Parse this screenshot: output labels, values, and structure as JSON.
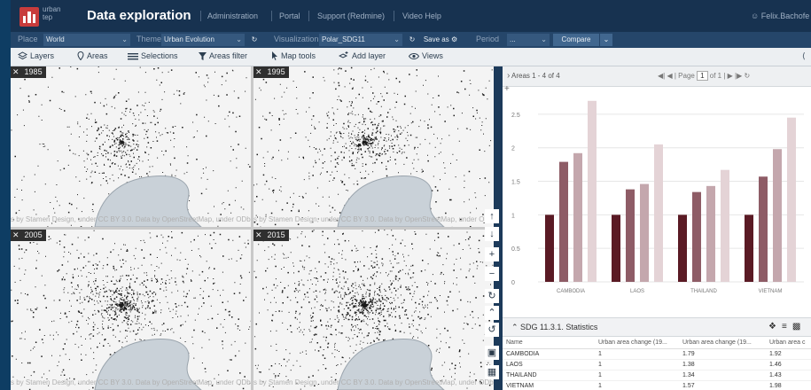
{
  "header": {
    "logo_text": "urban tep",
    "title": "Data exploration",
    "nav": [
      "Administration",
      "Portal",
      "Support (Redmine)",
      "Video Help"
    ],
    "user": "Felix.Bachofe"
  },
  "filters": {
    "place_label": "Place",
    "place_value": "World",
    "theme_label": "Theme",
    "theme_value": "Urban Evolution",
    "visualization_label": "Visualization",
    "visualization_value": "Polar_SDG11",
    "saveas_label": "Save as",
    "period_label": "Period",
    "period_value": "...",
    "compare_label": "Compare"
  },
  "toolbar": {
    "layers": "Layers",
    "areas": "Areas",
    "selections": "Selections",
    "areas_filter": "Areas filter",
    "map_tools": "Map tools",
    "add_layer": "Add layer",
    "views": "Views"
  },
  "maps": [
    {
      "year": "1985"
    },
    {
      "year": "1995"
    },
    {
      "year": "2005"
    },
    {
      "year": "2015"
    }
  ],
  "map_attribution": "s by Stamen Design, under CC BY 3.0. Data by OpenStreetMap, under ODbL",
  "map_controls": [
    "arrow-up",
    "arrow-down",
    "zoom-in",
    "zoom-out",
    "rotate-cw",
    "north",
    "rotate-ccw",
    "layers-grid",
    "grid"
  ],
  "panel": {
    "areas_count": "Areas 1 - 4 of 4",
    "page_label": "Page",
    "page_value": "1",
    "of_label": "of 1"
  },
  "chart_data": {
    "type": "bar",
    "categories": [
      "CAMBODIA",
      "LAOS",
      "THAILAND",
      "VIETNAM"
    ],
    "series": [
      {
        "values": [
          1,
          1,
          1,
          1
        ]
      },
      {
        "values": [
          1.79,
          1.38,
          1.34,
          1.57
        ]
      },
      {
        "values": [
          1.92,
          1.46,
          1.43,
          1.98
        ]
      },
      {
        "values": [
          2.7,
          2.05,
          1.67,
          2.45
        ]
      }
    ],
    "colors": [
      "#5a1a24",
      "#8e5c66",
      "#c4a7ad",
      "#e4d3d6"
    ],
    "yticks": [
      "0",
      "0.5",
      "1",
      "1.5",
      "2",
      "2.5"
    ],
    "ylim": [
      0,
      2.75
    ],
    "grid": true
  },
  "stats": {
    "title": "SDG 11.3.1. Statistics",
    "columns": [
      "Name",
      "Urban area change (19...",
      "Urban area change (19...",
      "Urban area c"
    ],
    "rows": [
      [
        "CAMBODIA",
        "1",
        "1.79",
        "1.92"
      ],
      [
        "LAOS",
        "1",
        "1.38",
        "1.46"
      ],
      [
        "THAILAND",
        "1",
        "1.34",
        "1.43"
      ],
      [
        "VIETNAM",
        "1",
        "1.57",
        "1.98"
      ]
    ]
  }
}
